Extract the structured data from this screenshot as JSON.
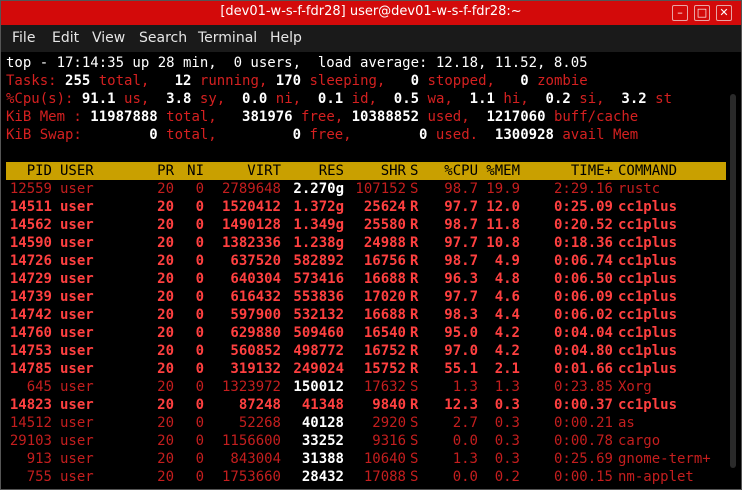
{
  "window": {
    "title": "[dev01-w-s-f-fdr28] user@dev01-w-s-f-fdr28:~"
  },
  "menu": [
    "File",
    "Edit",
    "View",
    "Search",
    "Terminal",
    "Help"
  ],
  "top": {
    "line1": "top - 17:14:35 up 28 min,  0 users,  load average: 12.18, 11.52, 8.05",
    "tasks": {
      "label": "Tasks:",
      "total": "255",
      "running": "12",
      "sleeping": "170",
      "stopped": "0",
      "zombie": "0"
    },
    "cpu": {
      "label": "%Cpu(s):",
      "us": "91.1",
      "sy": "3.8",
      "ni": "0.0",
      "id": "0.1",
      "wa": "0.5",
      "hi": "1.1",
      "si": "0.2",
      "st": "3.2"
    },
    "mem": {
      "label": "KiB Mem :",
      "total": "11987888",
      "free": "381976",
      "used": "10388852",
      "buff": "1217060"
    },
    "swap": {
      "label": "KiB Swap:",
      "total": "0",
      "free": "0",
      "used": "0",
      "avail": "1300928"
    }
  },
  "columns": [
    "PID",
    "USER",
    "PR",
    "NI",
    "VIRT",
    "RES",
    "SHR",
    "S",
    "%CPU",
    "%MEM",
    "TIME+",
    "COMMAND"
  ],
  "processes": [
    {
      "pid": "12559",
      "user": "user",
      "pr": "20",
      "ni": "0",
      "virt": "2789648",
      "res": "2.270g",
      "shr": "107152",
      "s": "S",
      "cpu": "98.7",
      "mem": "19.9",
      "time": "2:29.16",
      "cmd": "rustc",
      "bold": false
    },
    {
      "pid": "14511",
      "user": "user",
      "pr": "20",
      "ni": "0",
      "virt": "1520412",
      "res": "1.372g",
      "shr": "25624",
      "s": "R",
      "cpu": "97.7",
      "mem": "12.0",
      "time": "0:25.09",
      "cmd": "cc1plus",
      "bold": true
    },
    {
      "pid": "14562",
      "user": "user",
      "pr": "20",
      "ni": "0",
      "virt": "1490128",
      "res": "1.349g",
      "shr": "25580",
      "s": "R",
      "cpu": "98.7",
      "mem": "11.8",
      "time": "0:20.52",
      "cmd": "cc1plus",
      "bold": true
    },
    {
      "pid": "14590",
      "user": "user",
      "pr": "20",
      "ni": "0",
      "virt": "1382336",
      "res": "1.238g",
      "shr": "24988",
      "s": "R",
      "cpu": "97.7",
      "mem": "10.8",
      "time": "0:18.36",
      "cmd": "cc1plus",
      "bold": true
    },
    {
      "pid": "14726",
      "user": "user",
      "pr": "20",
      "ni": "0",
      "virt": "637520",
      "res": "582892",
      "shr": "16756",
      "s": "R",
      "cpu": "98.7",
      "mem": "4.9",
      "time": "0:06.74",
      "cmd": "cc1plus",
      "bold": true
    },
    {
      "pid": "14729",
      "user": "user",
      "pr": "20",
      "ni": "0",
      "virt": "640304",
      "res": "573416",
      "shr": "16688",
      "s": "R",
      "cpu": "96.3",
      "mem": "4.8",
      "time": "0:06.50",
      "cmd": "cc1plus",
      "bold": true
    },
    {
      "pid": "14739",
      "user": "user",
      "pr": "20",
      "ni": "0",
      "virt": "616432",
      "res": "553836",
      "shr": "17020",
      "s": "R",
      "cpu": "97.7",
      "mem": "4.6",
      "time": "0:06.09",
      "cmd": "cc1plus",
      "bold": true
    },
    {
      "pid": "14742",
      "user": "user",
      "pr": "20",
      "ni": "0",
      "virt": "597900",
      "res": "532132",
      "shr": "16688",
      "s": "R",
      "cpu": "98.3",
      "mem": "4.4",
      "time": "0:06.02",
      "cmd": "cc1plus",
      "bold": true
    },
    {
      "pid": "14760",
      "user": "user",
      "pr": "20",
      "ni": "0",
      "virt": "629880",
      "res": "509460",
      "shr": "16540",
      "s": "R",
      "cpu": "95.0",
      "mem": "4.2",
      "time": "0:04.04",
      "cmd": "cc1plus",
      "bold": true
    },
    {
      "pid": "14753",
      "user": "user",
      "pr": "20",
      "ni": "0",
      "virt": "560852",
      "res": "498772",
      "shr": "16752",
      "s": "R",
      "cpu": "97.0",
      "mem": "4.2",
      "time": "0:04.80",
      "cmd": "cc1plus",
      "bold": true
    },
    {
      "pid": "14785",
      "user": "user",
      "pr": "20",
      "ni": "0",
      "virt": "319132",
      "res": "249024",
      "shr": "15752",
      "s": "R",
      "cpu": "55.1",
      "mem": "2.1",
      "time": "0:01.66",
      "cmd": "cc1plus",
      "bold": true
    },
    {
      "pid": "645",
      "user": "user",
      "pr": "20",
      "ni": "0",
      "virt": "1323972",
      "res": "150012",
      "shr": "17632",
      "s": "S",
      "cpu": "1.3",
      "mem": "1.3",
      "time": "0:23.85",
      "cmd": "Xorg",
      "bold": false
    },
    {
      "pid": "14823",
      "user": "user",
      "pr": "20",
      "ni": "0",
      "virt": "87248",
      "res": "41348",
      "shr": "9840",
      "s": "R",
      "cpu": "12.3",
      "mem": "0.3",
      "time": "0:00.37",
      "cmd": "cc1plus",
      "bold": true
    },
    {
      "pid": "14512",
      "user": "user",
      "pr": "20",
      "ni": "0",
      "virt": "52268",
      "res": "40128",
      "shr": "2920",
      "s": "S",
      "cpu": "2.7",
      "mem": "0.3",
      "time": "0:00.21",
      "cmd": "as",
      "bold": false
    },
    {
      "pid": "29103",
      "user": "user",
      "pr": "20",
      "ni": "0",
      "virt": "1156600",
      "res": "33252",
      "shr": "9316",
      "s": "S",
      "cpu": "0.0",
      "mem": "0.3",
      "time": "0:00.78",
      "cmd": "cargo",
      "bold": false
    },
    {
      "pid": "913",
      "user": "user",
      "pr": "20",
      "ni": "0",
      "virt": "843004",
      "res": "31388",
      "shr": "10640",
      "s": "S",
      "cpu": "1.3",
      "mem": "0.3",
      "time": "0:25.69",
      "cmd": "gnome-term+",
      "bold": false
    },
    {
      "pid": "755",
      "user": "user",
      "pr": "20",
      "ni": "0",
      "virt": "1753660",
      "res": "28432",
      "shr": "17088",
      "s": "S",
      "cpu": "0.0",
      "mem": "0.2",
      "time": "0:00.15",
      "cmd": "nm-applet",
      "bold": false
    }
  ],
  "colors": {
    "titlebar": "#d30a0a",
    "header_bg": "#c9a000",
    "text_red": "#d42020",
    "text_bold_red": "#ff4040"
  }
}
